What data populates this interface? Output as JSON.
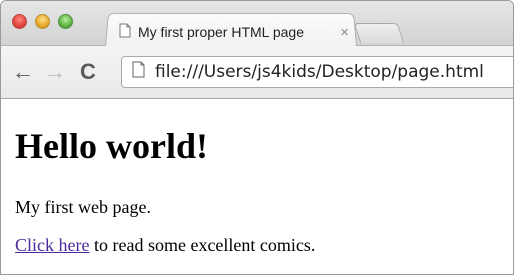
{
  "browser": {
    "tab": {
      "title": "My first proper HTML page",
      "close_glyph": "×",
      "icon": "document-icon"
    },
    "toolbar": {
      "back_glyph": "←",
      "forward_glyph": "→",
      "reload_glyph": "C",
      "url": "file:///Users/js4kids/Desktop/page.html"
    },
    "window_controls": [
      "close",
      "minimize",
      "zoom"
    ]
  },
  "page": {
    "heading": "Hello world!",
    "paragraph": "My first web page.",
    "link_text": "Click here",
    "link_suffix": " to read some excellent comics."
  },
  "colors": {
    "link": "#4a2a9c",
    "close_light": "#e0443e",
    "minimize_light": "#e8a82b",
    "zoom_light": "#5fb245"
  }
}
